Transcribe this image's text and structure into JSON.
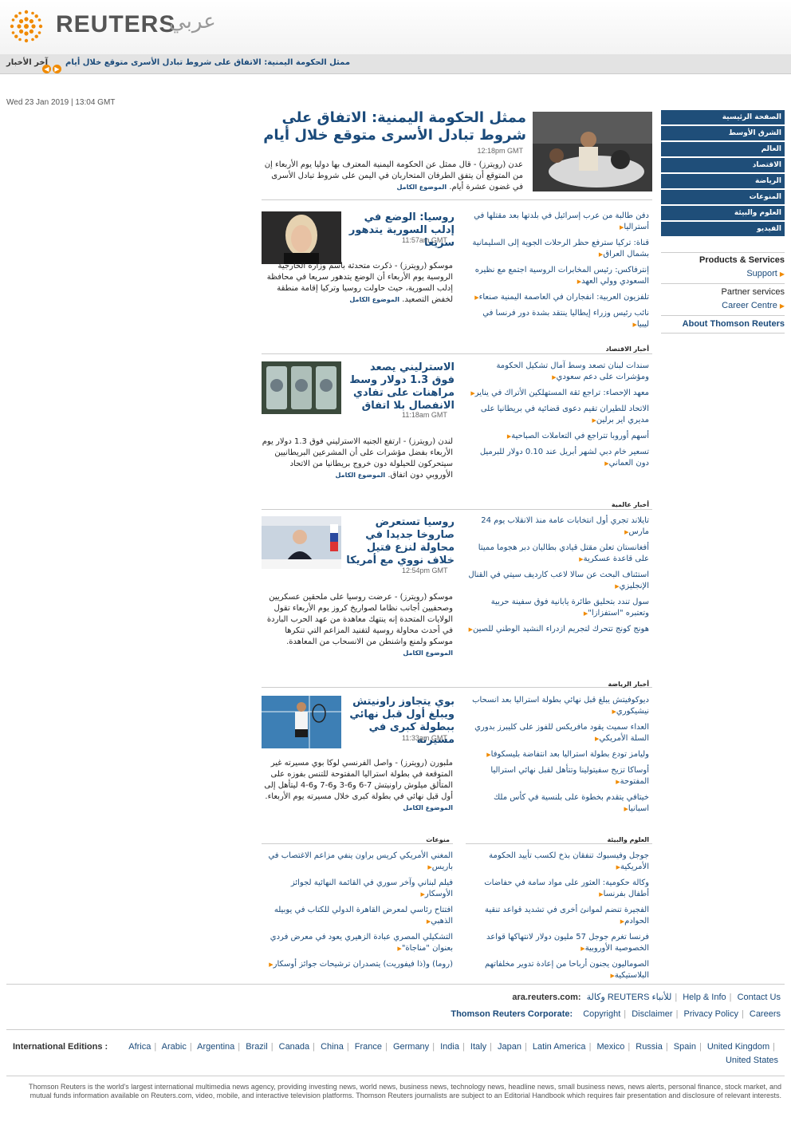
{
  "header": {
    "logo_text": "REUTERS",
    "logo_arabic": "عربي",
    "ticker_label": "آخر الأخبار",
    "ticker_headline": "ممثل الحكومة اليمنية: الاتفاق على شروط تبادل الأسرى متوقع خلال أيام"
  },
  "datetime": "Wed 23 Jan 2019 | 13:04 GMT",
  "nav": {
    "items": [
      "الصفحة الرئيسية",
      "الشرق الأوسط",
      "العالم",
      "الاقتصاد",
      "الرياضة",
      "المنوعات",
      "العلوم والبيئة",
      "الفيديو"
    ]
  },
  "services": {
    "products_title": "Products & Services",
    "support": "Support",
    "partner_title": "Partner services",
    "career": "Career Centre",
    "about": "About Thomson Reuters"
  },
  "lead": {
    "title": "ممثل الحكومة اليمنية: الاتفاق على شروط تبادل الأسرى متوقع خلال أيام",
    "time": "12:18pm GMT",
    "body": "عدن (رويترز) - قال ممثل عن الحكومة اليمنية المعترف بها دوليا يوم الأربعاء إن من المتوقع أن يتفق الطرفان المتحاربان في اليمن على شروط تبادل الأسرى في غضون عشرة أيام.",
    "more": "الموضوع الكامل"
  },
  "stories": [
    {
      "title": "روسيا: الوضع في إدلب السورية يتدهور سريعا",
      "time": "11:57am GMT",
      "body": "موسكو (رويترز) - ذكرت متحدثة باسم وزارة الخارجية الروسية يوم الأربعاء أن الوضع يتدهور سريعا في محافظة إدلب السورية، حيث حاولت روسيا وتركيا إقامة منطقة لخفض التصعيد.",
      "more": "الموضوع الكامل"
    },
    {
      "title": "الاسترليني يصعد فوق 1.3 دولار وسط مراهنات على تفادي الانفصال بلا اتفاق",
      "time": "11:18am GMT",
      "body": "لندن (رويترز) - ارتفع الجنيه الاسترليني فوق 1.3 دولار يوم الأربعاء بفضل مؤشرات على أن المشرعين البريطانيين سيتحركون للحيلولة دون خروج بريطانيا من الاتحاد الأوروبي دون اتفاق.",
      "more": "الموضوع الكامل"
    },
    {
      "title": "روسيا تستعرض صاروخا جديدا في محاولة لنزع فتيل خلاف نووي مع أمريكا",
      "time": "12:54pm GMT",
      "body": "موسكو (رويترز) - عرضت روسيا على ملحقين عسكريين وصحفيين أجانب نظاما لصواريخ كروز يوم الأربعاء تقول الولايات المتحدة إنه ينتهك معاهدة من عهد الحرب الباردة في أحدث محاولة روسية لتفنيد المزاعم التي تنكرها موسكو ولمنع واشنطن من الانسحاب من المعاهدة.",
      "more": "الموضوع الكامل"
    },
    {
      "title": "بوي يتجاوز راونيتش ويبلغ أول قبل نهائي ببطولة كبرى في مسيرته",
      "time": "11:33am GMT",
      "body": "ملبورن (رويترز) - واصل الفرنسي لوكا بوي مسيرته غير المتوقعة في بطولة استراليا المفتوحة للتنس بفوزه على المتألق ميلوش راونيتش 7-6 و6-3 و6-7 و6-4 ليتأهل إلى أول قبل نهائي في بطولة كبرى خلال مسيرته يوم الأربعاء.",
      "more": "الموضوع الكامل"
    }
  ],
  "middle_east_list": [
    "دفن طالبة من عرب إسرائيل في بلدتها بعد مقتلها في أستراليا",
    "قناة: تركيا سترفع حظر الرحلات الجوية إلى السليمانية بشمال العراق",
    "إنترفاكس: رئيس المخابرات الروسية اجتمع مع نظيره السعودي وولي العهد",
    "تلفزيون العربية: انفجاران في العاصمة اليمنية صنعاء",
    "نائب رئيس وزراء إيطاليا ينتقد بشدة دور فرنسا في ليبيا"
  ],
  "economy": {
    "head": "أخبار الاقتصاد",
    "items": [
      "سندات لبنان تصعد وسط آمال تشكيل الحكومة ومؤشرات على دعم سعودي",
      "معهد الإحصاء: تراجع ثقة المستهلكين الأتراك في يناير",
      "الاتحاد للطيران تقيم دعوى قضائية في بريطانيا على مديري اير برلين",
      "أسهم أوروبا تتراجع في التعاملات الصباحية",
      "تسعير خام دبي لشهر أبريل عند 0.10 دولار للبرميل دون العماني"
    ]
  },
  "world": {
    "head": "أخبار عالمية",
    "items": [
      "تايلاند تجري أول انتخابات عامة منذ الانقلاب يوم 24 مارس",
      "أفغانستان تعلن مقتل قيادي بطالبان دبر هجوما مميتا على قاعدة عسكرية",
      "استئناف البحث عن سالا لاعب كارديف سيتي في القنال الإنجليزي",
      "سول تندد بتحليق طائرة يابانية فوق سفينة حربية وتعتبره \"استفزازا\"",
      "هونج كونج تتحرك لتجريم ازدراء النشيد الوطني للصين"
    ]
  },
  "sports": {
    "head": "أخبار الرياضة",
    "items": [
      "ديوكوفيتش يبلغ قبل نهائي بطولة استراليا بعد انسحاب نيشيكوري",
      "العداء سميث يقود مافريكس للفوز على كليبرز بدوري السلة الأمريكي",
      "وليامز تودع بطولة استراليا بعد انتفاضة بليسكوفا",
      "أوساكا تزيح سفيتولينا وتتأهل لقبل نهائي استراليا المفتوحة",
      "خيتافي يتقدم بخطوة على بلنسية في كأس ملك اسبانيا"
    ]
  },
  "science": {
    "head": "العلوم والبيئة",
    "items": [
      "جوجل وفيسبوك تنفقان بذخ لكسب تأييد الحكومة الأمريكية",
      "وكالة حكومية: العثور على مواد سامة في حفاضات أطفال بفرنسا",
      "الفجيرة تنضم لموانئ أخرى في تشديد قواعد تنقية الحوادم",
      "فرنسا تغرم جوجل 57 مليون دولار لانتهاكها قواعد الخصوصية الأوروبية",
      "الصوماليون يجنون أرباحا من إعادة تدوير مخلفاتهم البلاستيكية"
    ]
  },
  "misc": {
    "head": "منوعات",
    "items": [
      "المغني الأمريكي كريس براون ينفي مزاعم الاغتصاب في باريس",
      "فيلم لبناني وآخر سوري في القائمة النهائية لجوائز الأوسكار",
      "افتتاح رئاسي لمعرض القاهرة الدولي للكتاب في يوبيله الذهبي",
      "التشكيلي المصري عبادة الزهيري يعود في معرض فردي بعنوان \"مناجاة\"",
      "(روما) و(ذا فيفوريت) يتصدران ترشيحات جوائز أوسكار"
    ]
  },
  "footer": {
    "site": "ara.reuters.com:",
    "agency": "وكالة REUTERS للأنباء",
    "help": "Help & Info",
    "contact": "Contact Us",
    "corporate": "Thomson Reuters Corporate:",
    "corp_links": [
      "Copyright",
      "Disclaimer",
      "Privacy Policy",
      "Careers"
    ],
    "editions_label": "International Editions :",
    "editions": [
      "Africa",
      "Arabic",
      "Argentina",
      "Brazil",
      "Canada",
      "China",
      "France",
      "Germany",
      "India",
      "Italy",
      "Japan",
      "Latin America",
      "Mexico",
      "Russia",
      "Spain",
      "United Kingdom",
      "United States"
    ],
    "disclaimer": "Thomson Reuters is the world's largest international multimedia news agency, providing investing news, world news, business news, technology news, headline news, small business news, news alerts, personal finance, stock market, and mutual funds information available on Reuters.com, video, mobile, and interactive television platforms. Thomson Reuters journalists are subject to an Editorial Handbook which requires fair presentation and disclosure of relevant interests."
  },
  "colors": {
    "brand": "#1f4e79",
    "accent": "#f08a00",
    "link": "#1a4a7a"
  }
}
